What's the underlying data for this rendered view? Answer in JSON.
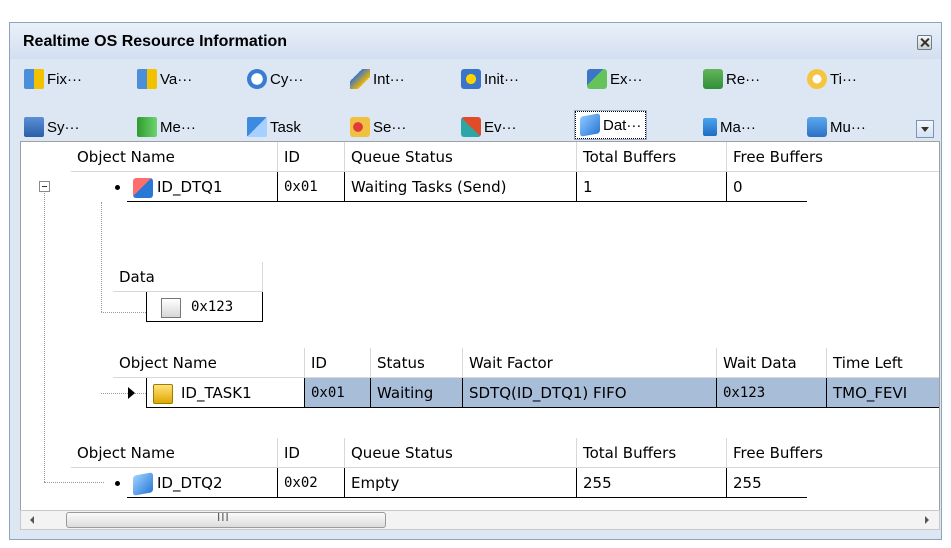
{
  "window": {
    "title": "Realtime OS Resource Information"
  },
  "toolbar": {
    "row1": [
      {
        "label": "Fix···",
        "icon": "fixed-memory-pool-icon"
      },
      {
        "label": "Va···",
        "icon": "variable-memory-pool-icon"
      },
      {
        "label": "Cy···",
        "icon": "cyclic-handler-icon"
      },
      {
        "label": "Int···",
        "icon": "interrupt-handler-icon"
      },
      {
        "label": "Init···",
        "icon": "initialization-routine-icon"
      },
      {
        "label": "Ex···",
        "icon": "extended-svc-icon"
      },
      {
        "label": "Re···",
        "icon": "ready-queue-icon"
      },
      {
        "label": "Ti···",
        "icon": "timer-queue-icon"
      }
    ],
    "row2": [
      {
        "label": "Sy···",
        "icon": "system-status-icon"
      },
      {
        "label": "Me···",
        "icon": "memory-icon"
      },
      {
        "label": "Task",
        "icon": "task-icon"
      },
      {
        "label": "Se···",
        "icon": "semaphore-icon"
      },
      {
        "label": "Ev···",
        "icon": "eventflag-icon"
      },
      {
        "label": "Dat···",
        "icon": "data-queue-icon",
        "active": true
      },
      {
        "label": "Ma···",
        "icon": "mailbox-icon"
      },
      {
        "label": "Mu···",
        "icon": "mutex-icon"
      }
    ]
  },
  "headers": {
    "dtq": [
      "Object Name",
      "ID",
      "Queue Status",
      "Total Buffers",
      "Free Buffers"
    ],
    "data": "Data",
    "task": [
      "Object Name",
      "ID",
      "Status",
      "Wait Factor",
      "Wait Data",
      "Time Left"
    ]
  },
  "dtq1": {
    "name": "ID_DTQ1",
    "id": "0x01",
    "queue_status": "Waiting Tasks (Send)",
    "total_buffers": "1",
    "free_buffers": "0",
    "data_value": "0x123"
  },
  "task1": {
    "name": "ID_TASK1",
    "id": "0x01",
    "status": "Waiting",
    "wait_factor": "SDTQ(ID_DTQ1) FIFO",
    "wait_data": "0x123",
    "time_left": "TMO_FEVI"
  },
  "dtq2": {
    "name": "ID_DTQ2",
    "id": "0x02",
    "queue_status": "Empty",
    "total_buffers": "255",
    "free_buffers": "255"
  },
  "scrollbar": {
    "grip": "III"
  }
}
